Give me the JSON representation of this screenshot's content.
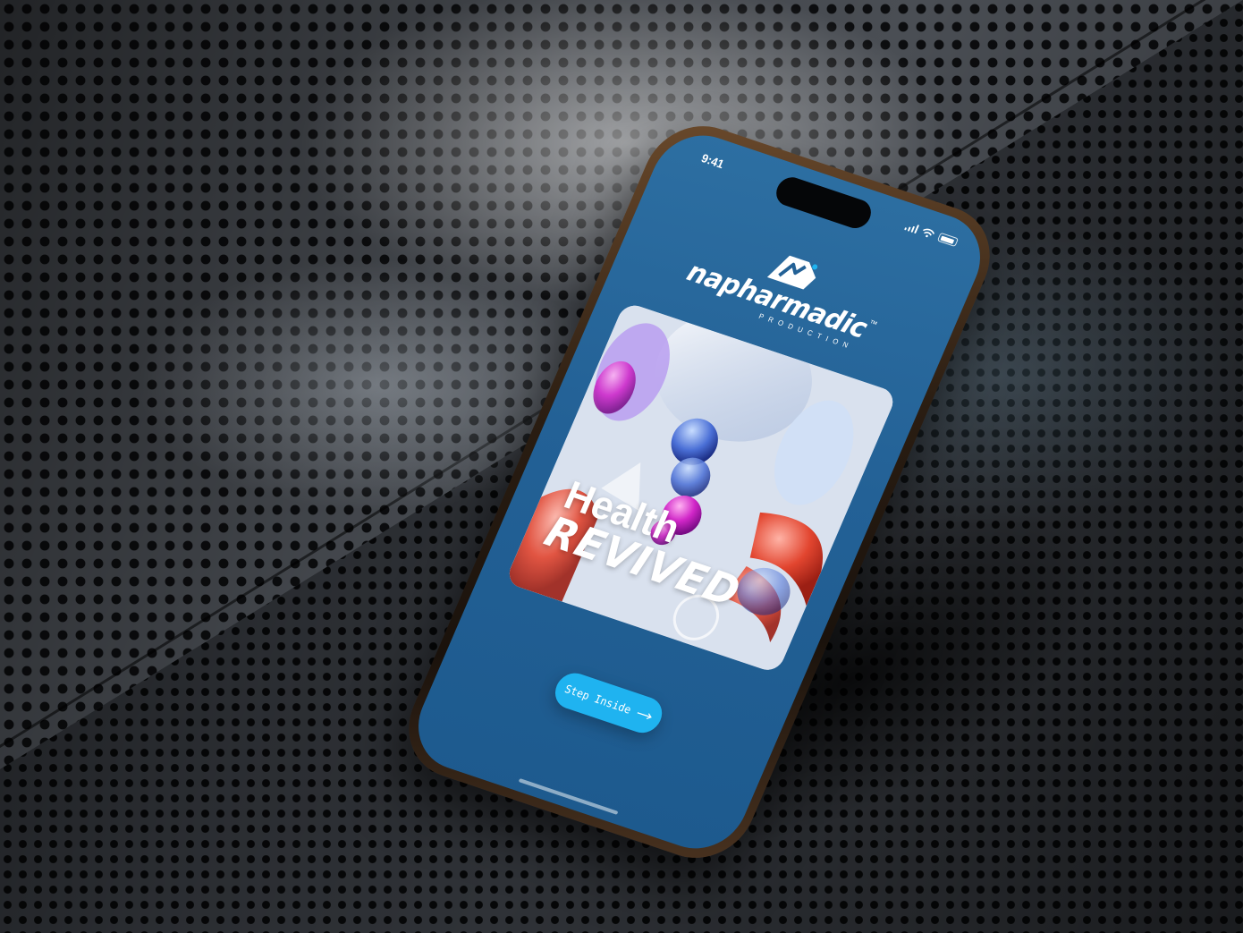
{
  "status_bar": {
    "time": "9:41"
  },
  "logo": {
    "wordmark": "napharmadic",
    "trademark": "™",
    "subtitle": "PRODUCTION"
  },
  "hero": {
    "title_line_1": "Health",
    "title_line_2": "REVIVED"
  },
  "cta": {
    "label": "Step Inside",
    "icon": "arrow-right-icon"
  },
  "colors": {
    "screen_bg": "#236196",
    "cta_bg": "#1fb3f0",
    "text": "#ffffff"
  }
}
